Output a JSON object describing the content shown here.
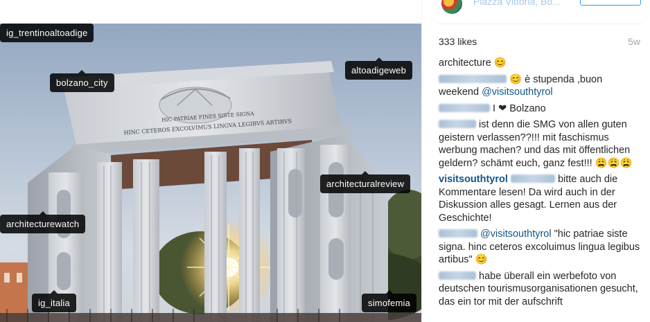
{
  "post": {
    "location": "Piazza Vittoria, Bo...",
    "likes": "333 likes",
    "age": "5w"
  },
  "photo": {
    "inscription_line1": "HIC PATRIAE FINES SISTE SIGNA",
    "inscription_line2": "HINC CETEROS EXCOLVIMUS LINGVA LEGIBVS ARTIBVS"
  },
  "tags": [
    "ig_trentinoaltoadige",
    "bolzano_city",
    "altoadigeweb",
    "architecturalreview",
    "architecturewatch",
    "ig_italia",
    "simofemia"
  ],
  "comments": {
    "c0_text": "architecture 😊",
    "c1_text": " 😊 è stupenda ,buon weekend ",
    "c1_mention": "@visitsouthtyrol",
    "c2_text": " I ❤ Bolzano",
    "c3_text": " ist denn die SMG von allen guten geistern verlassen??!!! mit faschismus werbung machen? und das mit öffentlichen geldern? schämt euch, ganz fest!!! 😩😩😩",
    "c4_user": "visitsouthtyrol",
    "c4_text": " bitte auch die Kommentare lesen! Da wird auch in der Diskussion alles gesagt. Lernen aus der Geschichte!",
    "c5_mention": "@visitsouthtyrol",
    "c5_text": " \"hic patriae siste signa. hinc ceteros excoluimus lingua legibus artibus\" 😊",
    "c6_text": " habe überall ein werbefoto von deutschen tourismusorganisationen gesucht, das ein tor mit der aufschrift"
  }
}
